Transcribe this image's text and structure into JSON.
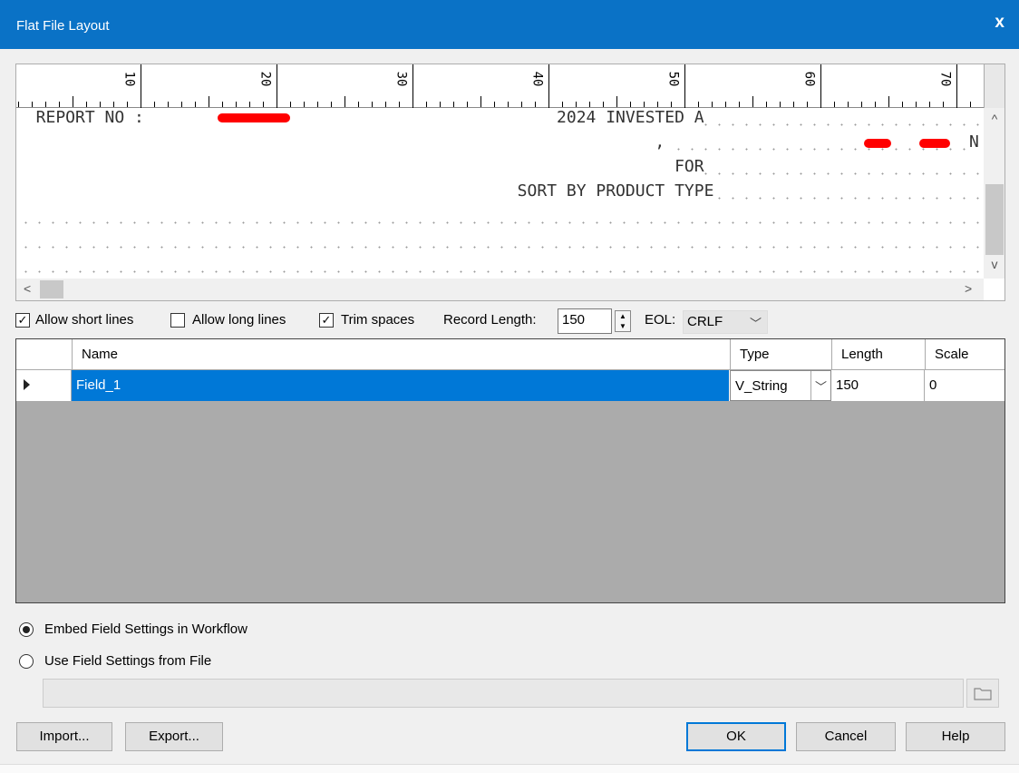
{
  "window": {
    "title": "Flat File Layout",
    "close_glyph": "x"
  },
  "preview": {
    "ruler_labels": [
      "10",
      "20",
      "30",
      "40",
      "50",
      "60",
      "70"
    ],
    "lines": [
      "  REPORT NO :                                          2024 INVESTED A",
      "                                                                 , ",
      "                                                                   FOR",
      "                                                   SORT BY PRODUCT TYPE",
      "",
      ""
    ],
    "line2_tail": "N",
    "scroll_up": "^",
    "scroll_down": "v",
    "scroll_left": "<",
    "scroll_right": ">"
  },
  "options": {
    "allow_short_lines": {
      "label": "Allow short lines",
      "checked": true
    },
    "allow_long_lines": {
      "label": "Allow long lines",
      "checked": false
    },
    "trim_spaces": {
      "label": "Trim spaces",
      "checked": true
    },
    "record_length_label": "Record Length:",
    "record_length_value": "150",
    "eol_label": "EOL:",
    "eol_value": "CRLF"
  },
  "grid": {
    "columns": [
      "Name",
      "Type",
      "Length",
      "Scale"
    ],
    "rows": [
      {
        "name": "Field_1",
        "type": "V_String",
        "length": "150",
        "scale": "0"
      }
    ]
  },
  "field_settings": {
    "embed_label": "Embed Field Settings in Workflow",
    "use_file_label": "Use Field Settings from File",
    "selected": "embed",
    "path_value": ""
  },
  "buttons": {
    "import": "Import...",
    "export": "Export...",
    "ok": "OK",
    "cancel": "Cancel",
    "help": "Help"
  },
  "colors": {
    "titlebar": "#0a72c6",
    "selection": "#0078d7",
    "redaction": "#ff0000"
  }
}
